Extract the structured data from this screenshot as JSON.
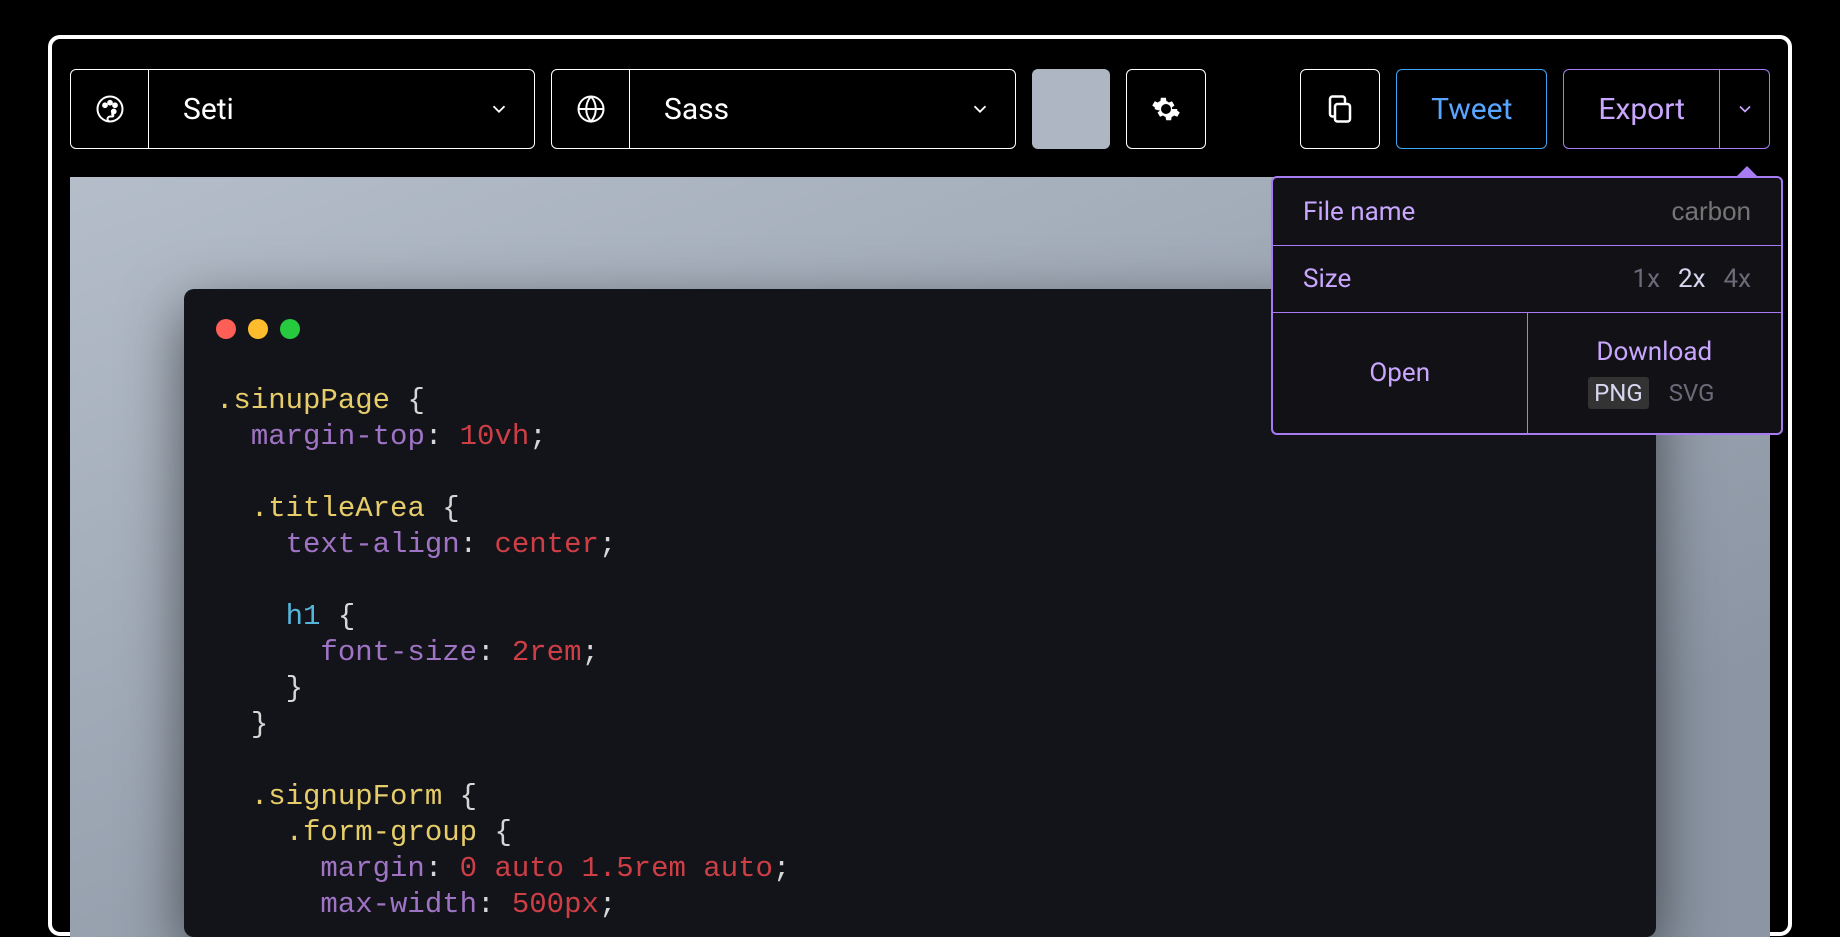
{
  "toolbar": {
    "theme_label": "Seti",
    "language_label": "Sass",
    "tweet_label": "Tweet",
    "export_label": "Export"
  },
  "export_menu": {
    "filename_label": "File name",
    "filename_placeholder": "carbon",
    "size_label": "Size",
    "sizes": [
      "1x",
      "2x",
      "4x"
    ],
    "size_selected": "2x",
    "open_label": "Open",
    "download_label": "Download",
    "formats": [
      "PNG",
      "SVG"
    ],
    "format_selected": "PNG"
  },
  "code": {
    "line1_sel": ".sinupPage",
    "line2_prop": "margin-top",
    "line2_val": "10vh",
    "line3_sel": ".titleArea",
    "line4_prop": "text-align",
    "line4_val": "center",
    "line5_sel": "h1",
    "line6_prop": "font-size",
    "line6_val": "2rem",
    "line7_sel": ".signupForm",
    "line8_sel": ".form-group",
    "line9_prop": "margin",
    "line9_val": "0 auto 1.5rem auto",
    "line10_prop": "max-width",
    "line10_val": "500px"
  }
}
